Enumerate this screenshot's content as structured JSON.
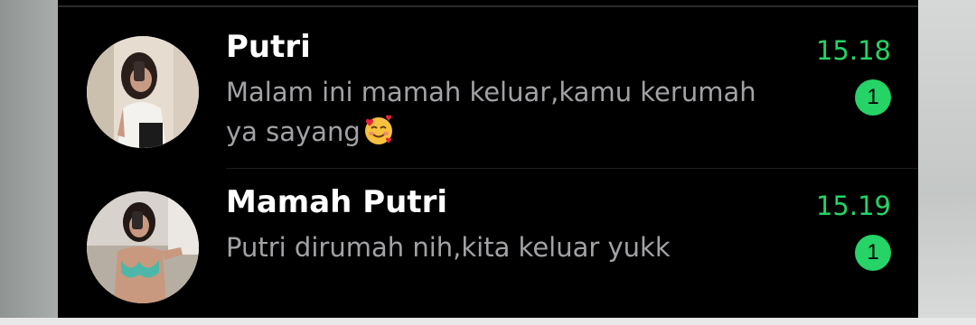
{
  "chat_list": {
    "items": [
      {
        "name": "Putri",
        "message_line1": "Malam ini mamah keluar,kamu kerumah",
        "message_line2": "ya sayang",
        "emoji": "smiling-face-with-hearts",
        "time": "15.18",
        "unread_count": "1"
      },
      {
        "name": "Mamah Putri",
        "message_line1": "Putri dirumah nih,kita keluar yukk",
        "time": "15.19",
        "unread_count": "1"
      }
    ]
  },
  "colors": {
    "background": "#000000",
    "name_text": "#ffffff",
    "preview_text": "#a2a2a6",
    "accent_green": "#25d366",
    "badge_text": "#000000"
  }
}
